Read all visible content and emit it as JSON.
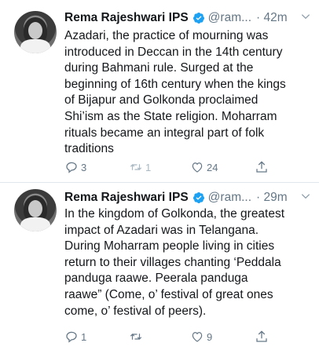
{
  "tweets": [
    {
      "name": "Rema Rajeshwari IPS",
      "handle": "@ram...",
      "time": "· 42m",
      "text": "Azadari, the practice of mourning was\nintroduced in Deccan in the 14th century\nduring Bahmani rule. Surged at the\nbeginning of 16th century when the kings\nof Bijapur and Golkonda proclaimed\nShi’ism as the State religion. Moharram\nrituals became an integral part of folk\ntraditions",
      "replies": "3",
      "retweets": "1",
      "likes": "24"
    },
    {
      "name": "Rema Rajeshwari IPS",
      "handle": "@ram...",
      "time": "· 29m",
      "text": "In the kingdom of Golkonda, the greatest\nimpact of Azadari was in Telangana.\nDuring Moharram people living in cities\nreturn to their villages chanting ‘Peddala\npanduga raawe. Peerala panduga\nraawe” (Come, o’ festival of great ones\ncome, o’ festival of peers).",
      "replies": "1",
      "retweets": "",
      "likes": "9"
    }
  ],
  "colors": {
    "verified": "#1da1f2",
    "muted": "#657786",
    "text": "#14171a"
  },
  "icons": [
    "verified-badge-icon",
    "chevron-down-icon",
    "reply-icon",
    "retweet-icon",
    "like-icon",
    "share-icon"
  ]
}
